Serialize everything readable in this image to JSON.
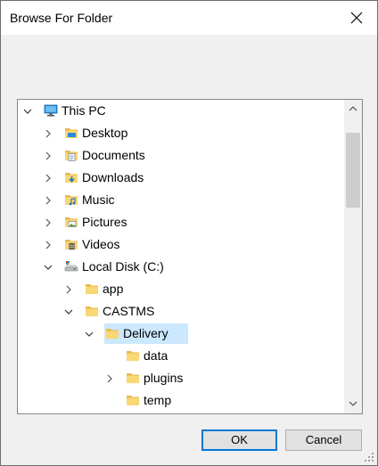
{
  "window": {
    "title": "Browse For Folder"
  },
  "tree": {
    "items": [
      {
        "label": "This PC",
        "state": "expanded",
        "icon": "this-pc-icon",
        "depth": 0
      },
      {
        "label": "Desktop",
        "state": "collapsed",
        "icon": "desktop-folder-icon",
        "depth": 1
      },
      {
        "label": "Documents",
        "state": "collapsed",
        "icon": "documents-folder-icon",
        "depth": 1
      },
      {
        "label": "Downloads",
        "state": "collapsed",
        "icon": "downloads-folder-icon",
        "depth": 1
      },
      {
        "label": "Music",
        "state": "collapsed",
        "icon": "music-folder-icon",
        "depth": 1
      },
      {
        "label": "Pictures",
        "state": "collapsed",
        "icon": "pictures-folder-icon",
        "depth": 1
      },
      {
        "label": "Videos",
        "state": "collapsed",
        "icon": "videos-folder-icon",
        "depth": 1
      },
      {
        "label": "Local Disk (C:)",
        "state": "expanded",
        "icon": "local-disk-icon",
        "depth": 1
      },
      {
        "label": "app",
        "state": "collapsed",
        "icon": "folder-icon",
        "depth": 2
      },
      {
        "label": "CASTMS",
        "state": "expanded",
        "icon": "folder-icon",
        "depth": 2
      },
      {
        "label": "Delivery",
        "state": "expanded",
        "icon": "folder-icon",
        "depth": 3,
        "selected": true
      },
      {
        "label": "data",
        "state": "none",
        "icon": "folder-icon",
        "depth": 4
      },
      {
        "label": "plugins",
        "state": "collapsed",
        "icon": "folder-icon",
        "depth": 4
      },
      {
        "label": "temp",
        "state": "none",
        "icon": "folder-icon",
        "depth": 4
      }
    ]
  },
  "buttons": {
    "ok": "OK",
    "cancel": "Cancel"
  },
  "colors": {
    "selection": "#cce8ff",
    "accent": "#0078d7",
    "folder": "#f8d775"
  }
}
